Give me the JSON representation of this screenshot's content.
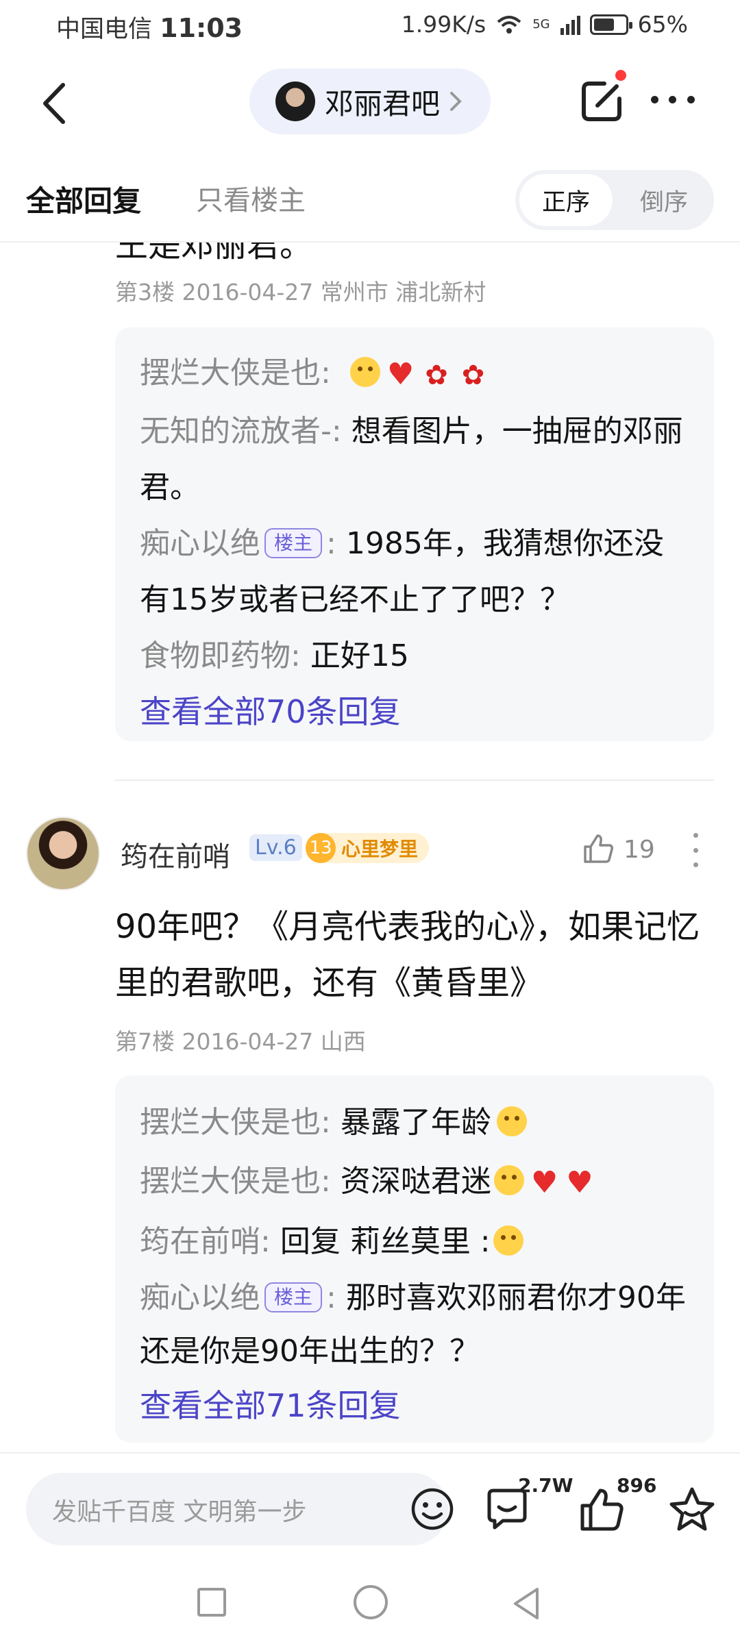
{
  "status_bar": {
    "carrier": "中国电信",
    "time": "11:03",
    "net_speed": "1.99K/s",
    "signal": "5G",
    "battery_percent": "65%",
    "battery_level": 0.65
  },
  "nav": {
    "forum_name": "邓丽君吧"
  },
  "tabs": {
    "all_replies": "全部回复",
    "op_only": "只看楼主",
    "order_asc": "正序",
    "order_desc": "倒序"
  },
  "floor3": {
    "partial_text": "王是邓丽君。",
    "meta": "第3楼  2016-04-27  常州市 浦北新村",
    "replies": [
      {
        "author": "摆烂大侠是也",
        "sep": ":",
        "text": ""
      },
      {
        "author": "无知的流放者-",
        "sep": ":",
        "text": "想看图片，一抽屉的邓丽君。"
      },
      {
        "author": "痴心以绝",
        "badge": "楼主",
        "sep": ":",
        "text": "1985年，我猜想你还没有15岁或者已经不止了了吧？？"
      },
      {
        "author": "食物即药物",
        "sep": ":",
        "text": "正好15"
      }
    ],
    "view_all": "查看全部70条回复"
  },
  "floor7": {
    "username": "筠在前哨",
    "level": "Lv.6",
    "fan_level": "13",
    "fan_badge": "心里梦里",
    "likes": "19",
    "body": "90年吧？《月亮代表我的心》，如果记忆里的君歌吧，还有《黄昏里》",
    "meta": "第7楼  2016-04-27  山西",
    "replies": [
      {
        "author": "摆烂大侠是也",
        "sep": ":",
        "text": "暴露了年龄"
      },
      {
        "author": "摆烂大侠是也",
        "sep": ":",
        "text": "资深哒君迷"
      },
      {
        "author": "筠在前哨",
        "sep": ":",
        "text": "回复 莉丝莫里 :"
      },
      {
        "author": "痴心以绝",
        "badge": "楼主",
        "sep": ":",
        "text": "那时喜欢邓丽君你才90年还是你是90年出生的？？"
      }
    ],
    "view_all": "查看全部71条回复"
  },
  "bottom_bar": {
    "placeholder": "发贴千百度 文明第一步",
    "comment_count": "2.7W",
    "like_count": "896"
  },
  "colors": {
    "accent": "#4b44c7",
    "badge_purple": "#6a5fd8",
    "notify_red": "#ff3a3a",
    "fan_orange": "#e18a00"
  }
}
